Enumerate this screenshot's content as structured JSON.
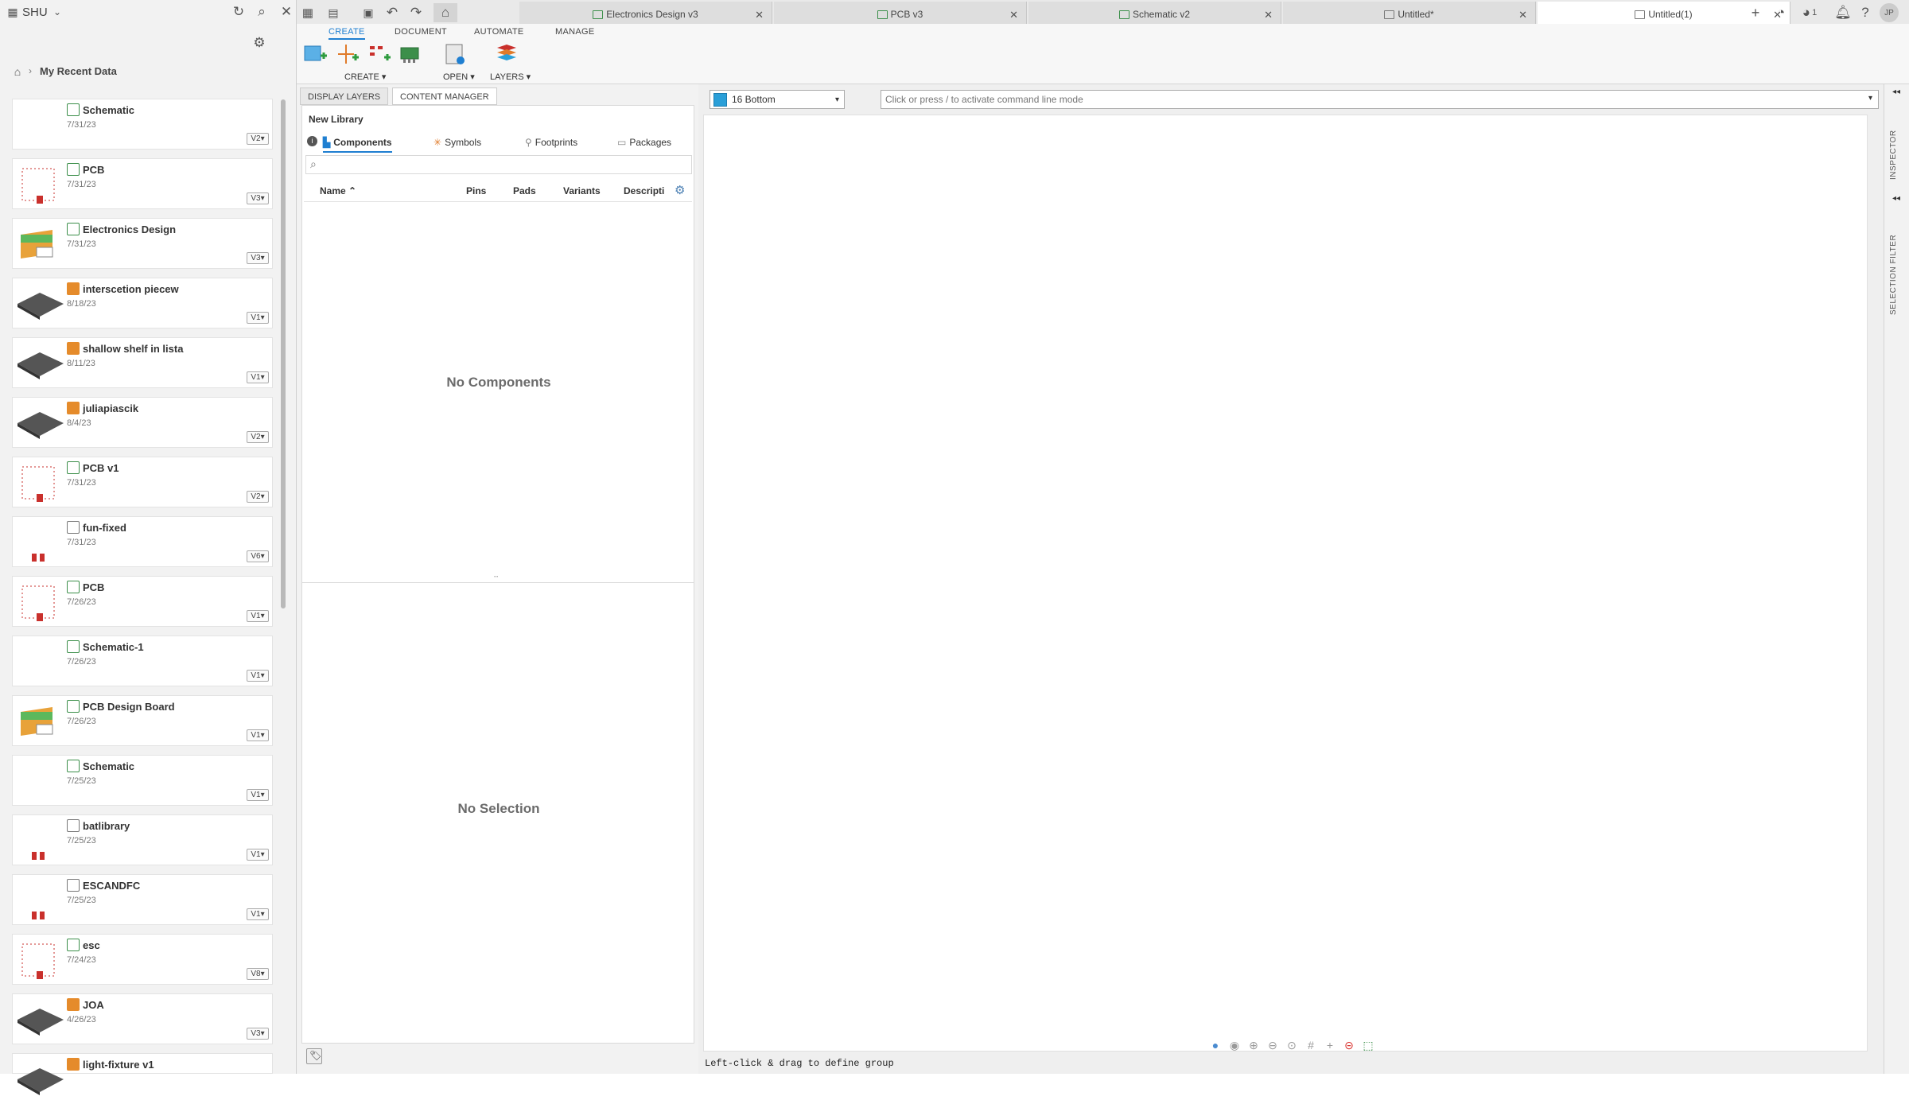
{
  "left_panel": {
    "hub_name": "SHU",
    "breadcrumb": "My Recent Data",
    "items": [
      {
        "title": "Schematic",
        "date": "7/31/23",
        "version": "V2",
        "type": "schematic"
      },
      {
        "title": "PCB",
        "date": "7/31/23",
        "version": "V3",
        "type": "pcb"
      },
      {
        "title": "Electronics Design",
        "date": "7/31/23",
        "version": "V3",
        "type": "electronics"
      },
      {
        "title": "interscetion piecew",
        "date": "8/18/23",
        "version": "V1",
        "type": "model"
      },
      {
        "title": "shallow shelf in lista",
        "date": "8/11/23",
        "version": "V1",
        "type": "model"
      },
      {
        "title": "juliapiascik",
        "date": "8/4/23",
        "version": "V2",
        "type": "model"
      },
      {
        "title": "PCB v1",
        "date": "7/31/23",
        "version": "V2",
        "type": "pcb"
      },
      {
        "title": "fun-fixed",
        "date": "7/31/23",
        "version": "V6",
        "type": "library"
      },
      {
        "title": "PCB",
        "date": "7/26/23",
        "version": "V1",
        "type": "pcb"
      },
      {
        "title": "Schematic-1",
        "date": "7/26/23",
        "version": "V1",
        "type": "schematic"
      },
      {
        "title": "PCB Design Board",
        "date": "7/26/23",
        "version": "V1",
        "type": "electronics"
      },
      {
        "title": "Schematic",
        "date": "7/25/23",
        "version": "V1",
        "type": "schematic"
      },
      {
        "title": "batlibrary",
        "date": "7/25/23",
        "version": "V1",
        "type": "library"
      },
      {
        "title": "ESCANDFC",
        "date": "7/25/23",
        "version": "V1",
        "type": "library"
      },
      {
        "title": "esc",
        "date": "7/24/23",
        "version": "V8",
        "type": "pcb"
      },
      {
        "title": "JOA",
        "date": "4/26/23",
        "version": "V3",
        "type": "model"
      },
      {
        "title": "light-fixture v1",
        "date": "",
        "version": "",
        "type": "model"
      }
    ]
  },
  "tabs": [
    {
      "label": "Electronics Design v3",
      "icon": "electronics-icon",
      "active": false
    },
    {
      "label": "PCB v3",
      "icon": "pcb-icon",
      "active": false
    },
    {
      "label": "Schematic v2",
      "icon": "schematic-icon",
      "active": false
    },
    {
      "label": "Untitled*",
      "icon": "document-icon",
      "active": false
    },
    {
      "label": "Untitled(1)",
      "icon": "document-icon",
      "active": true
    }
  ],
  "topbar_right": {
    "job_count": "1",
    "user_initials": "JP"
  },
  "ribbon": {
    "tabs": [
      "CREATE",
      "DOCUMENT",
      "AUTOMATE",
      "MANAGE"
    ],
    "active_tab": "CREATE",
    "groups": {
      "create": "CREATE",
      "open": "OPEN",
      "layers": "LAYERS"
    }
  },
  "content_manager": {
    "pane_tabs": [
      "DISPLAY LAYERS",
      "CONTENT MANAGER"
    ],
    "library_title": "New Library",
    "subtabs": [
      "Components",
      "Symbols",
      "Footprints",
      "Packages"
    ],
    "columns": [
      "Name",
      "Pins",
      "Pads",
      "Variants",
      "Descripti"
    ],
    "empty_components": "No Components",
    "empty_selection": "No Selection"
  },
  "canvas": {
    "layer": "16 Bottom",
    "layer_color": "#2a9fd8",
    "command_placeholder": "Click or press / to activate command line mode",
    "status": "Left-click & drag to define group"
  },
  "right_sidebar": {
    "inspector": "INSPECTOR",
    "selection_filter": "SELECTION FILTER"
  },
  "colors": {
    "accent": "#1f7fd1",
    "pcb_green": "#3c8f4a",
    "model_orange": "#e58b2b"
  }
}
